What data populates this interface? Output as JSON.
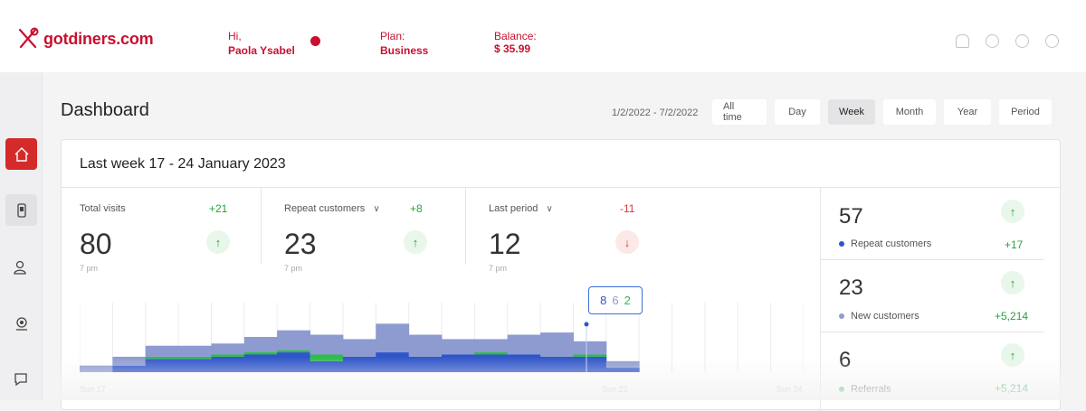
{
  "brand": {
    "name": "gotdiners.com",
    "color": "#c8102e"
  },
  "header": {
    "greeting": "Hi,",
    "user_name": "Paola Ysabel",
    "plan_label": "Plan:",
    "plan_value": "Business",
    "balance_label": "Balance:",
    "balance_value": "$ 35.99",
    "icons": [
      "bell-icon",
      "refresh-icon",
      "info-icon",
      "download-icon"
    ]
  },
  "sidebar": {
    "items": [
      {
        "name": "home",
        "icon": "home-icon",
        "active": true
      },
      {
        "name": "mobile",
        "icon": "phone-icon",
        "selected": true
      },
      {
        "name": "users",
        "icon": "users-icon"
      },
      {
        "name": "location",
        "icon": "map-pin-icon"
      },
      {
        "name": "chat",
        "icon": "chat-icon"
      }
    ]
  },
  "dashboard": {
    "title": "Dashboard",
    "date_range": "1/2/2022 - 7/2/2022",
    "filters": [
      "All time",
      "Day",
      "Week",
      "Month",
      "Year",
      "Period"
    ],
    "active_filter": "Week"
  },
  "card": {
    "title": "Last week 17 - 24 January 2023",
    "stats": [
      {
        "label": "Total visits",
        "delta": "+21",
        "value": "80",
        "sub": "7 pm",
        "trend": "up"
      },
      {
        "label": "Repeat customers",
        "delta": "+8",
        "value": "23",
        "sub": "7 pm",
        "trend": "up"
      },
      {
        "label": "Last period",
        "delta": "-11",
        "value": "12",
        "sub": "7 pm",
        "trend": "down"
      }
    ],
    "tooltip": {
      "a": "8",
      "b": "6",
      "c": "2"
    },
    "x_labels": [
      "Sun 17",
      "Sun 22",
      "Sun 24"
    ],
    "summary": [
      {
        "value": "57",
        "label": "Repeat customers",
        "delta": "+17",
        "dot": "#2f55c9"
      },
      {
        "value": "23",
        "label": "New customers",
        "delta": "+5,214",
        "dot": "#8d9bd0"
      },
      {
        "value": "6",
        "label": "Referrals",
        "delta": "+5,214",
        "dot": "#2dbb4a"
      }
    ]
  },
  "chart_data": {
    "type": "bar",
    "stacked": true,
    "series": [
      {
        "color": "#2f55c9",
        "values": [
          0,
          3,
          6,
          6,
          7,
          8,
          9,
          5,
          7,
          9,
          7,
          8,
          8,
          8,
          7,
          7,
          2,
          0,
          0,
          0,
          0,
          0
        ]
      },
      {
        "color": "#2dbb4a",
        "values": [
          0,
          0,
          1,
          1,
          1,
          1,
          1,
          3,
          0,
          0,
          0,
          0,
          1,
          0,
          0,
          1,
          0,
          0,
          0,
          0,
          0,
          0
        ]
      },
      {
        "color": "#8d9bd0",
        "values": [
          3,
          4,
          5,
          5,
          5,
          7,
          9,
          9,
          8,
          13,
          10,
          7,
          6,
          9,
          11,
          6,
          3,
          0,
          0,
          0,
          0,
          0
        ]
      }
    ],
    "ylim": [
      0,
      30
    ],
    "grid": true,
    "colors": {
      "primary": "#2f55c9",
      "secondary": "#8d9bd0",
      "accent": "#2dbb4a"
    }
  }
}
